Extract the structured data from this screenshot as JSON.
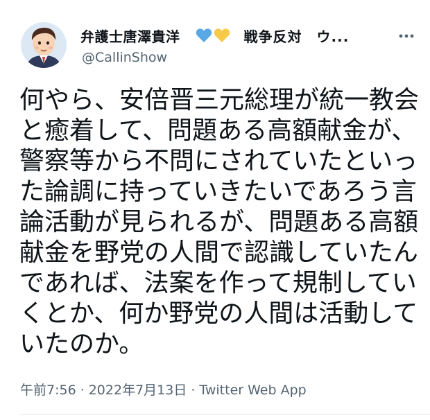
{
  "author": {
    "display_name": "弁護士唐澤貴洋",
    "name_suffix": "戦争反対　ウ...",
    "handle": "@CallinShow",
    "hearts": [
      {
        "icon": "blue-heart-icon",
        "color": "#5aa7e6"
      },
      {
        "icon": "yellow-heart-icon",
        "color": "#f7c948"
      }
    ]
  },
  "tweet": {
    "lines": [
      "何やら、安倍晋三元総理が統一教会",
      "と癒着して、問題ある高額献金が、",
      "警察等から不問にされていたといっ",
      "た論調に持っていきたいであろう言",
      "論活動が見られるが、問題ある高額",
      "献金を野党の人間で認識していたん",
      "であれば、法案を作って規制してい",
      "くとか、何か野党の人間は活動して",
      "いたのか。"
    ]
  },
  "meta": {
    "time": "午前7:56",
    "separator": "·",
    "date": "2022年7月13日",
    "source": "Twitter Web App"
  },
  "icons": {
    "more": "more-dots-icon",
    "avatar": "avatar-cartoon"
  },
  "colors": {
    "text": "#0f1419",
    "secondary": "#536471",
    "divider": "#e6ecf0"
  }
}
